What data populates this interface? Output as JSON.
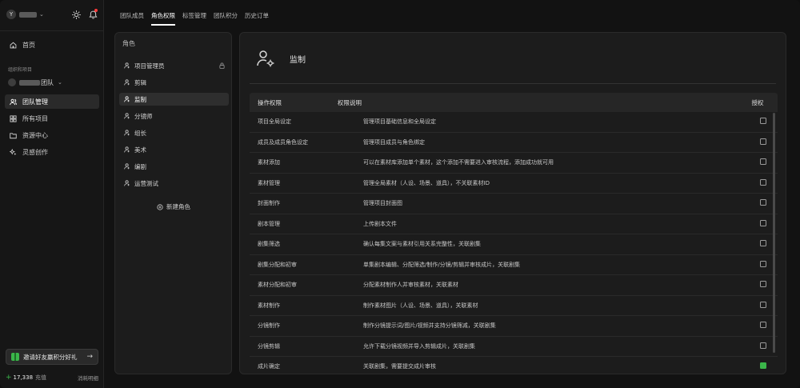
{
  "workspace": {
    "avatar_letter": "Y",
    "chevron": "⌄"
  },
  "sidebar": {
    "nav_home": "首页",
    "section_label": "组织和项目",
    "team_suffix": "团队",
    "items": [
      {
        "label": "团队管理",
        "icon": "team-icon",
        "active": true
      },
      {
        "label": "所有项目",
        "icon": "projects-icon",
        "active": false
      },
      {
        "label": "资源中心",
        "icon": "folder-icon",
        "active": false
      },
      {
        "label": "灵感创作",
        "icon": "sparkle-icon",
        "active": false
      }
    ],
    "invite_label": "邀请好友赢积分好礼",
    "invite_arrow": "→",
    "credits_plus": "+",
    "credits_value": "17,338",
    "credits_label": "充值",
    "credits_detail": "消耗明细"
  },
  "tabs": [
    {
      "label": "团队成员",
      "active": false
    },
    {
      "label": "角色权限",
      "active": true
    },
    {
      "label": "标签管理",
      "active": false
    },
    {
      "label": "团队积分",
      "active": false
    },
    {
      "label": "历史订单",
      "active": false
    }
  ],
  "roles": {
    "title": "角色",
    "items": [
      {
        "label": "项目管理员",
        "locked": true,
        "active": false
      },
      {
        "label": "剪辑",
        "locked": false,
        "active": false
      },
      {
        "label": "监制",
        "locked": false,
        "active": true
      },
      {
        "label": "分镜师",
        "locked": false,
        "active": false
      },
      {
        "label": "组长",
        "locked": false,
        "active": false
      },
      {
        "label": "美术",
        "locked": false,
        "active": false
      },
      {
        "label": "编剧",
        "locked": false,
        "active": false
      },
      {
        "label": "运营测试",
        "locked": false,
        "active": false
      }
    ],
    "new_role_label": "新建角色"
  },
  "detail": {
    "title": "监制",
    "columns": [
      "操作权限",
      "权限说明",
      "授权"
    ],
    "rows": [
      {
        "perm": "项目全局设定",
        "desc": "管理项目基础信息和全局设定",
        "checked": false
      },
      {
        "perm": "成员及成员角色设定",
        "desc": "管理项目成员与角色绑定",
        "checked": false
      },
      {
        "perm": "素材添加",
        "desc": "可以在素材库添加单个素材，这个添加不需要进入审核流程，添加成功就可用",
        "checked": false
      },
      {
        "perm": "素材管理",
        "desc": "管理全局素材（人设、场景、道具），不关联素材ID",
        "checked": false
      },
      {
        "perm": "封面制作",
        "desc": "管理项目封面图",
        "checked": false
      },
      {
        "perm": "剧本管理",
        "desc": "上传剧本文件",
        "checked": false
      },
      {
        "perm": "剧集筛选",
        "desc": "确认每集文案与素材引用关系完整性，关联剧集",
        "checked": false
      },
      {
        "perm": "剧集分配和初审",
        "desc": "单集剧本编辑、分配筛选/制作/分镜/剪辑并审核成片，关联剧集",
        "checked": false
      },
      {
        "perm": "素材分配和初审",
        "desc": "分配素材制作人并审核素材，关联素材",
        "checked": false
      },
      {
        "perm": "素材制作",
        "desc": "制作素材图片（人设、场景、道具），关联素材",
        "checked": false
      },
      {
        "perm": "分镜制作",
        "desc": "制作分镜提示词/图片/视频并支持分镜筛减，关联剧集",
        "checked": false
      },
      {
        "perm": "分镜剪辑",
        "desc": "允许下载分镜视频并导入剪辑成片，关联剧集",
        "checked": false
      },
      {
        "perm": "成片确定",
        "desc": "关联剧集，需要提交成片审核",
        "checked": true
      }
    ]
  },
  "colors": {
    "accent": "#3bb54a",
    "badge": "#ff3b3b",
    "bg": "#121212",
    "panel": "#1c1c1c"
  }
}
